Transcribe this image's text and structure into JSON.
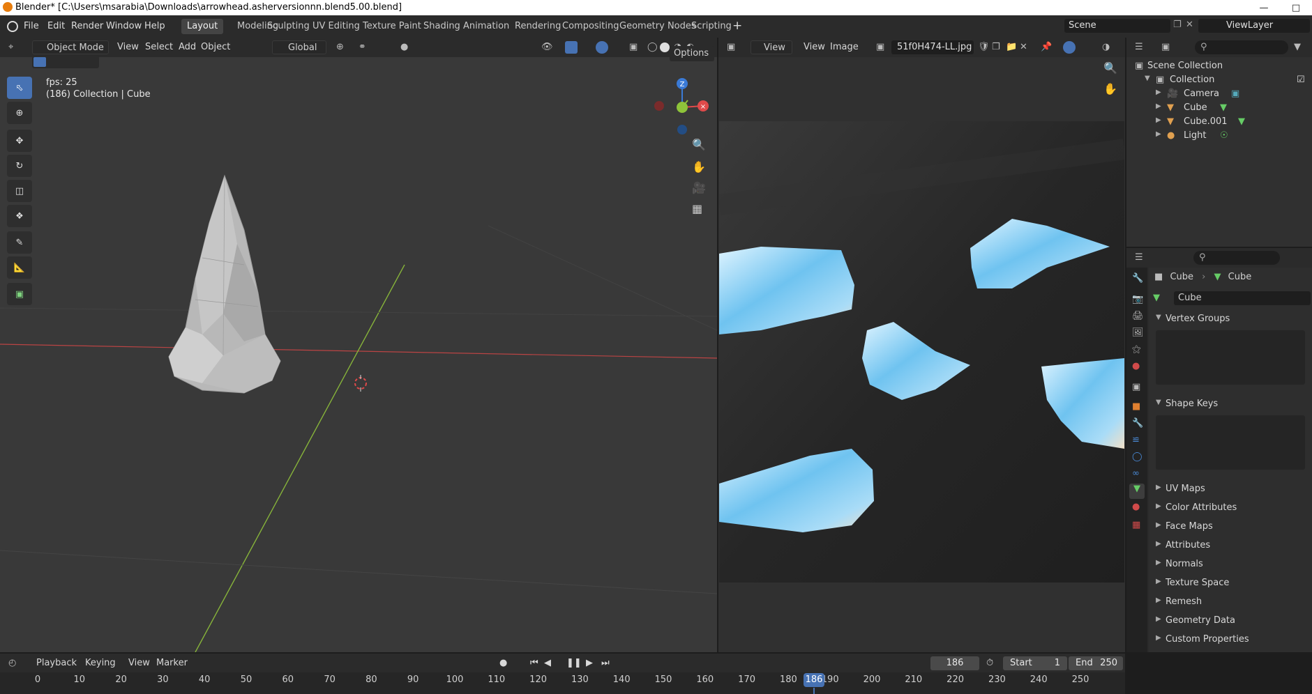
{
  "window": {
    "title": "Blender* [C:\\Users\\msarabia\\Downloads\\arrowhead.asherversionnn.blend5.00.blend]"
  },
  "menu": [
    "File",
    "Edit",
    "Render",
    "Window",
    "Help"
  ],
  "workspaces": [
    "Layout",
    "Modeling",
    "Sculpting",
    "UV Editing",
    "Texture Paint",
    "Shading",
    "Animation",
    "Rendering",
    "Compositing",
    "Geometry Nodes",
    "Scripting"
  ],
  "scene": {
    "name": "Scene",
    "view_layer": "ViewLayer"
  },
  "viewport": {
    "mode": "Object Mode",
    "menus": [
      "View",
      "Select",
      "Add",
      "Object"
    ],
    "orientation": "Global",
    "options_label": "Options",
    "fps_text": "fps: 25",
    "context_text": "(186) Collection | Cube",
    "gizmo_z": "Z"
  },
  "image_editor": {
    "view_mode": "View",
    "menus": [
      "View",
      "Image"
    ],
    "image_name": "51f0H474-LL.jpg"
  },
  "outliner": {
    "root": "Scene Collection",
    "collection": "Collection",
    "items": [
      "Camera",
      "Cube",
      "Cube.001",
      "Light"
    ]
  },
  "properties": {
    "breadcrumb_object": "Cube",
    "breadcrumb_data": "Cube",
    "data_name": "Cube",
    "panels": [
      "Vertex Groups",
      "Shape Keys",
      "UV Maps",
      "Color Attributes",
      "Face Maps",
      "Attributes",
      "Normals",
      "Texture Space",
      "Remesh",
      "Geometry Data",
      "Custom Properties"
    ]
  },
  "timeline": {
    "menus": [
      "Playback",
      "Keying",
      "View",
      "Marker"
    ],
    "current_frame": "186",
    "start_label": "Start",
    "start": "1",
    "end_label": "End",
    "end": "250",
    "ticks": [
      "0",
      "10",
      "20",
      "30",
      "40",
      "50",
      "60",
      "70",
      "80",
      "90",
      "100",
      "110",
      "120",
      "130",
      "140",
      "150",
      "160",
      "170",
      "180",
      "190",
      "200",
      "210",
      "220",
      "230",
      "240",
      "250"
    ]
  },
  "colors": {
    "accent": "#4772b3",
    "x_axis": "#e04a4a",
    "y_axis": "#8ec43a",
    "z_axis": "#3a7ad6",
    "frame_marker": "#4772b3"
  }
}
